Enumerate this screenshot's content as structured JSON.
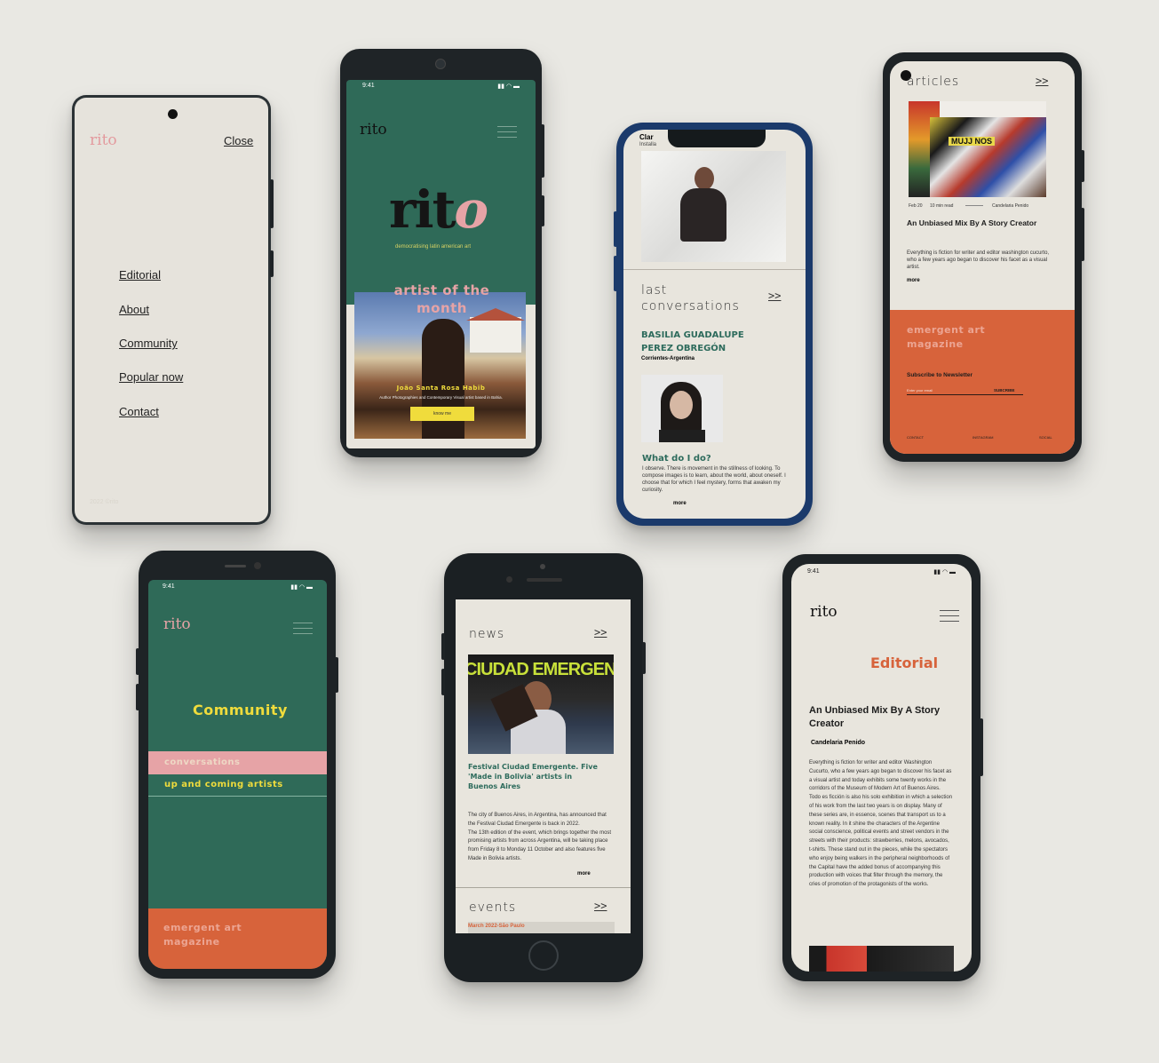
{
  "status_time": "9:41",
  "brand": "rito",
  "menu": {
    "close_label": "Close",
    "items": [
      "Editorial",
      "About",
      "Community",
      "Popular now",
      "Contact"
    ],
    "footer": "2022 ©rito"
  },
  "home": {
    "logo": "rito",
    "tagline": "democratising latin american art",
    "section": "artist of the month",
    "artist_name": "João Santa Rosa Habib",
    "artist_desc": "Author Photographies and Contemporary Visual artist based in Bahia.",
    "button": "know me"
  },
  "conversations": {
    "top_title": "Clar",
    "top_sub": "Installa",
    "heading_line1": "last",
    "heading_line2": "conversations",
    "arrow": ">>",
    "name": "BASILIA GUADALUPE PEREZ OBREGÓN",
    "location": "Corrientes-Argentina",
    "question": "What do I do?",
    "answer": "I observe. There is movement in the stillness of looking. To compose images is to learn, about the world, about oneself. I choose that for which I feel mystery, forms that awaken my curiosity.",
    "more": "more"
  },
  "articles": {
    "heading": "articles",
    "arrow": ">>",
    "meta_date": "Feb 20",
    "meta_read": "10 min read",
    "meta_author": "Candelaria Penido",
    "title": "An Unbiased Mix By A Story Creator",
    "excerpt": "Everything is fiction for writer and editor washington cucurto, who a few years ago began to discover his facet as a visual artist.",
    "more": "more",
    "mag_title": "emergent art magazine",
    "newsletter": "Subscribe to Newsletter",
    "email_placeholder": "Enter your email",
    "subscribe": "SUBCRIBE",
    "footer": [
      "CONTACT",
      "INSTAGRAM",
      "SOCIAL"
    ]
  },
  "community": {
    "title": "Community",
    "items": [
      "conversations",
      "up and coming artists"
    ],
    "mag_title": "emergent art magazine"
  },
  "news": {
    "heading": "news",
    "arrow": ">>",
    "banner_text": "CIUDAD EMERGENTE",
    "title": "Festival Ciudad Emergente. Five 'Made in Bolivia' artists in Buenos Aires",
    "body": "The city of Buenos Aires, in Argentina, has announced that the Festival Ciudad Emergente is back in 2022.\nThe 13th edition of the event, which brings together the most promising artists from across Argentina, will be taking place from Friday 8 to Monday 11 October and also features five Made in Bolivia artists.",
    "more": "more",
    "events_heading": "events",
    "events_arrow": ">>",
    "event_label": "March 2022-São Paulo"
  },
  "editorial": {
    "title": "Editorial",
    "article_title": "An Unbiased Mix By A Story Creator",
    "author": "Candelaria Penido",
    "body": "Everything is fiction for writer and editor Washington Cucurto, who a few years ago began to discover his facet as a visual artist and today exhibits some twenty works in the corridors of the Museum of Modern Art of Buenos Aires. Todo es ficción is also his solo exhibition in which a selection of his work from the last two years is on display. Many of these series are, in essence, scenes that transport us to a known reality. In it shine the characters of the Argentine social conscience, political events and street vendors in the streets with their products: strawberries, melons, avocados, t-shirts. These stand out in the pieces, while the spectators who enjoy being walkers in the peripheral neighborhoods of the Capital have the added bonus of accompanying this production with voices that filter through the memory, the cries of promotion of the protagonists of the works."
  },
  "colors": {
    "background": "#e9e8e3",
    "green": "#2f6a58",
    "orange": "#d7633b",
    "pink": "#e6a3a6",
    "yellow": "#f0dc3c",
    "cream": "#e8e5dd",
    "teal_text": "#2d6b5c"
  }
}
